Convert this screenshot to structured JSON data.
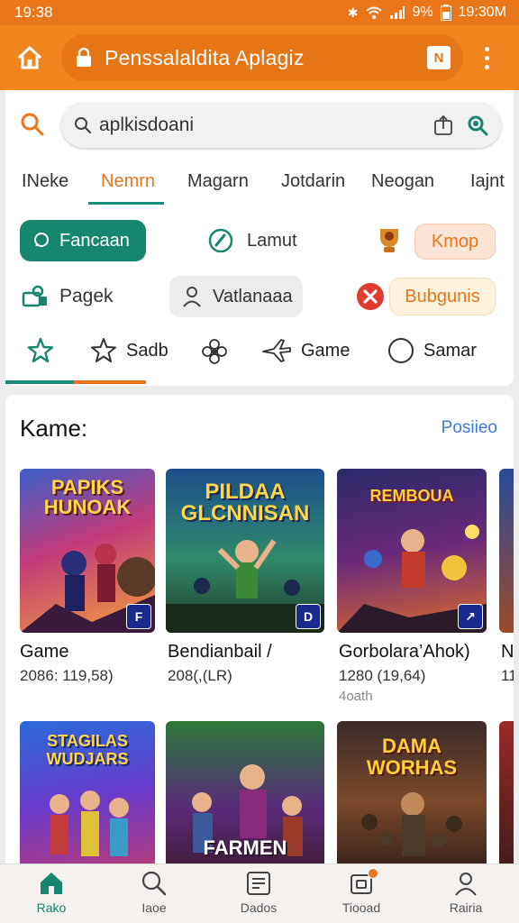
{
  "status": {
    "time_left": "19:38",
    "battery": "9%",
    "time_right": "19:30M"
  },
  "browser": {
    "url_title": "Penssalaldita Aplagiz",
    "reader_label": "N"
  },
  "search": {
    "query": "aplkisdoani"
  },
  "tabs": [
    "INeke",
    "Nemrn",
    "Magarn",
    "Jotdarin",
    "Neogan",
    "Iajnt"
  ],
  "chips": {
    "teal": "Fancaan",
    "plain": "Lamut",
    "peach": "Kmop",
    "pagek": "Pagek",
    "grey": "Vatlanaaa",
    "cream": "Bubgunis"
  },
  "icon_row": {
    "sadb": "Sadb",
    "game": "Game",
    "samam": "Samar"
  },
  "section": {
    "title": "Kame:",
    "link": "Posiieo"
  },
  "games_row1": [
    {
      "art": "PAPIKS HUNOAK",
      "title": "Game",
      "meta": "2086: 119,58)",
      "sub": ""
    },
    {
      "art": "PILDAA GLCNNISAN",
      "title": "Bendianbail /",
      "meta": "208(,(LR)",
      "sub": ""
    },
    {
      "art": "REMBOUA",
      "title": "Gorbolara’Ahok)",
      "meta": "1280 (19,64)",
      "sub": "4oath"
    }
  ],
  "games_row2": [
    {
      "art": "STAGILAS WUDJARS"
    },
    {
      "art": "FARMEN"
    },
    {
      "art": "DAMA WORHAS"
    }
  ],
  "peek_text": {
    "title": "N",
    "meta": "11"
  },
  "bottom_nav": [
    {
      "label": "Rako",
      "icon": "home-icon"
    },
    {
      "label": "Iaoe",
      "icon": "search-icon"
    },
    {
      "label": "Dados",
      "icon": "list-icon"
    },
    {
      "label": "Tiooad",
      "icon": "apps-icon"
    },
    {
      "label": "Rairia",
      "icon": "person-icon"
    }
  ],
  "colors": {
    "accent_orange": "#e9761a",
    "accent_teal": "#16866f",
    "link_blue": "#3d7bd9"
  }
}
